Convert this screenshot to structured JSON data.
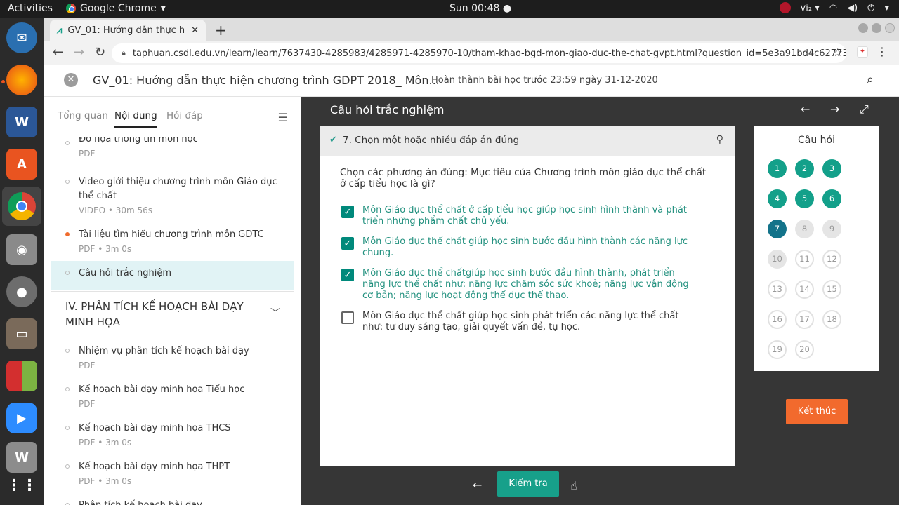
{
  "system": {
    "activities": "Activities",
    "app_name": "Google Chrome",
    "clock": "Sun 00:48",
    "input_method": "vi₂"
  },
  "browser": {
    "tab_title": "GV_01: Hướng dẫn thực h",
    "url": "taphuan.csdl.edu.vn/learn/learn/7637430-4285983/4285971-4285970-10/tham-khao-bgd-mon-giao-duc-the-chat-gvpt.html?question_id=5e3a91bd4c6277325d79..."
  },
  "course": {
    "title": "GV_01: Hướng dẫn thực hiện chương trình GDPT 2018_ Môn...",
    "deadline": "Hoàn thành bài học trước 23:59 ngày 31-12-2020"
  },
  "sidebar": {
    "tabs": [
      "Tổng quan",
      "Nội dung",
      "Hỏi đáp"
    ],
    "lessons_top": [
      {
        "title": "Đồ họa thông tin môn học",
        "meta": "PDF"
      },
      {
        "title": "Video giới thiệu chương trình môn Giáo dục thể chất",
        "meta": "VIDEO • 30m 56s"
      },
      {
        "title": "Tài liệu tìm hiểu chương trình môn GDTC",
        "meta": "PDF • 3m 0s"
      },
      {
        "title": "Câu hỏi trắc nghiệm",
        "meta": ""
      }
    ],
    "section": "IV. PHÂN TÍCH KẾ HOẠCH BÀI DẠY MINH HỌA",
    "lessons_bottom": [
      {
        "title": "Nhiệm vụ phân tích kế hoạch bài dạy",
        "meta": "PDF"
      },
      {
        "title": "Kế hoạch bài dạy minh họa Tiểu học",
        "meta": "PDF"
      },
      {
        "title": "Kế hoạch bài dạy minh họa THCS",
        "meta": "PDF • 3m 0s"
      },
      {
        "title": "Kế hoạch bài dạy minh họa THPT",
        "meta": "PDF • 3m 0s"
      },
      {
        "title": "Phân tích kế hoạch bài dạy",
        "meta": ""
      }
    ]
  },
  "quiz": {
    "header": "Câu hỏi trắc nghiệm",
    "type_label": "7. Chọn một hoặc nhiều đáp án đúng",
    "question": "Chọn các phương án đúng: Mục tiêu của Chương trình môn giáo dục thể chất ở cấp tiểu học là gì?",
    "options": [
      {
        "text": "Môn Giáo dục thể chất ở cấp tiểu học giúp học sinh hình thành và phát triển những phẩm chất chủ yếu.",
        "checked": true
      },
      {
        "text": "Môn Giáo dục thể chất giúp học sinh bước đầu hình thành các năng lực chung.",
        "checked": true
      },
      {
        "text": "Môn Giáo dục thể chấtgiúp học sinh bước đầu hình thành, phát triển năng lực thể chất như: năng lực chăm sóc sức khoẻ; năng lực vận động cơ bản; năng lực hoạt động thể dục thể thao.",
        "checked": true
      },
      {
        "text": "Môn Giáo dục thể chất giúp học sinh phát triển các năng lực thể chất như: tư duy sáng tạo, giải quyết vấn đề, tự học.",
        "checked": false
      }
    ],
    "check_label": "Kiểm tra"
  },
  "qnav": {
    "title": "Câu hỏi",
    "questions": [
      {
        "n": "1",
        "state": "done"
      },
      {
        "n": "2",
        "state": "done"
      },
      {
        "n": "3",
        "state": "done"
      },
      {
        "n": "4",
        "state": "done"
      },
      {
        "n": "5",
        "state": "done"
      },
      {
        "n": "6",
        "state": "done"
      },
      {
        "n": "7",
        "state": "cur"
      },
      {
        "n": "8",
        "state": "pending"
      },
      {
        "n": "9",
        "state": "pending"
      },
      {
        "n": "10",
        "state": "pending"
      },
      {
        "n": "11",
        "state": "empty"
      },
      {
        "n": "12",
        "state": "empty"
      },
      {
        "n": "13",
        "state": "empty"
      },
      {
        "n": "14",
        "state": "empty"
      },
      {
        "n": "15",
        "state": "empty"
      },
      {
        "n": "16",
        "state": "empty"
      },
      {
        "n": "17",
        "state": "empty"
      },
      {
        "n": "18",
        "state": "empty"
      },
      {
        "n": "19",
        "state": "empty"
      },
      {
        "n": "20",
        "state": "empty"
      }
    ],
    "finish_label": "Kết thúc"
  }
}
